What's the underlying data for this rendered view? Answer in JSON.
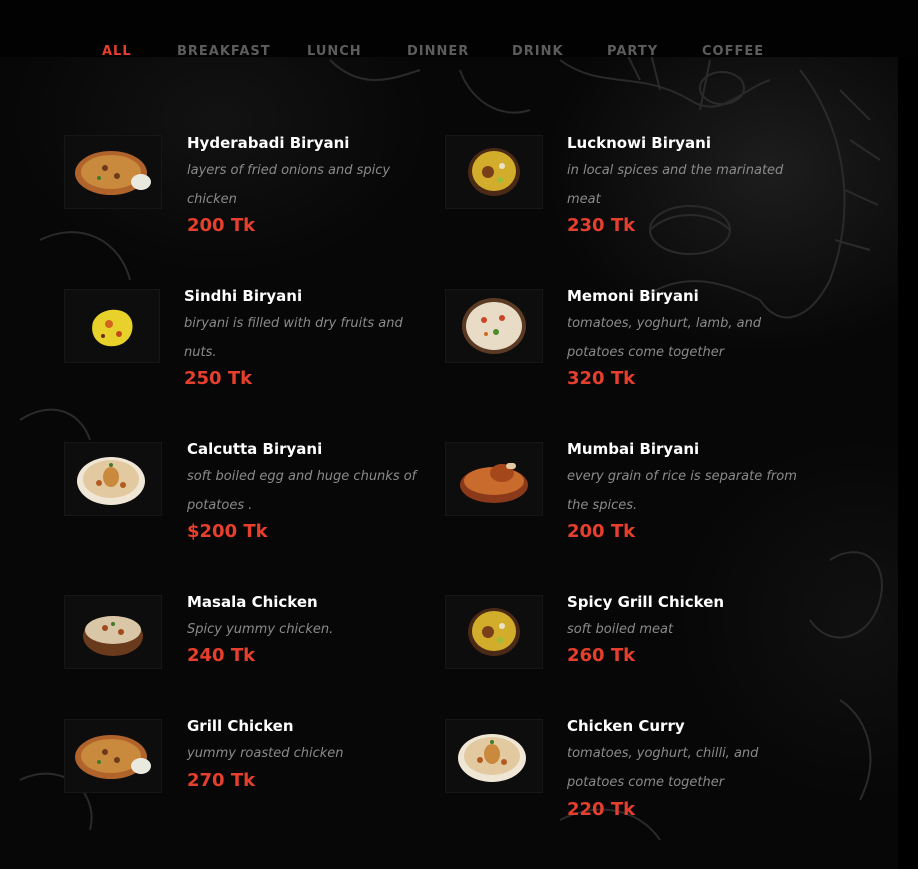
{
  "tabs": [
    {
      "label": "ALL",
      "active": true
    },
    {
      "label": "BREAKFAST",
      "active": false
    },
    {
      "label": "LUNCH",
      "active": false
    },
    {
      "label": "DINNER",
      "active": false
    },
    {
      "label": "DRINK",
      "active": false
    },
    {
      "label": "PARTY",
      "active": false
    },
    {
      "label": "COFFEE",
      "active": false
    }
  ],
  "colors": {
    "accent": "#e63f2d",
    "tab_inactive": "#5d5d5d",
    "item_title": "#ffffff",
    "description": "#8a8a8a",
    "background": "#070707"
  },
  "menu": {
    "items": [
      {
        "name": "Hyderabadi Biryani",
        "desc": [
          "layers of fried onions and spicy",
          "chicken"
        ],
        "price": "200 Tk",
        "icon": "biryani-plate-icon"
      },
      {
        "name": "Lucknowi Biryani",
        "desc": [
          "in local spices and the marinated",
          "meat"
        ],
        "price": "230 Tk",
        "icon": "biryani-bowl-icon"
      },
      {
        "name": "Sindhi Biryani",
        "desc": [
          "biryani is filled with dry fruits and",
          "nuts."
        ],
        "price": "250 Tk",
        "icon": "yellow-rice-icon"
      },
      {
        "name": "Memoni Biryani",
        "desc": [
          "tomatoes, yoghurt, lamb, and",
          "potatoes come together"
        ],
        "price": "320 Tk",
        "icon": "rice-bowl-icon"
      },
      {
        "name": "Calcutta Biryani",
        "desc": [
          "soft boiled egg and huge chunks of",
          "potatoes ."
        ],
        "price": "$200 Tk",
        "icon": "biryani-platter-icon"
      },
      {
        "name": "Mumbai Biryani",
        "desc": [
          "every grain of rice is separate from",
          "the spices."
        ],
        "price": "200 Tk",
        "icon": "chicken-leg-bowl-icon"
      },
      {
        "name": "Masala Chicken",
        "desc": [
          "Spicy yummy chicken."
        ],
        "price": "240 Tk",
        "icon": "masala-bowl-icon"
      },
      {
        "name": "Spicy Grill Chicken",
        "desc": [
          "soft boiled meat"
        ],
        "price": "260 Tk",
        "icon": "biryani-bowl-icon"
      },
      {
        "name": "Grill Chicken",
        "desc": [
          "yummy roasted chicken"
        ],
        "price": "270 Tk",
        "icon": "biryani-plate-icon"
      },
      {
        "name": "Chicken Curry",
        "desc": [
          "tomatoes, yoghurt, chilli, and",
          "potatoes come together"
        ],
        "price": "220 Tk",
        "icon": "biryani-platter-icon"
      }
    ]
  }
}
